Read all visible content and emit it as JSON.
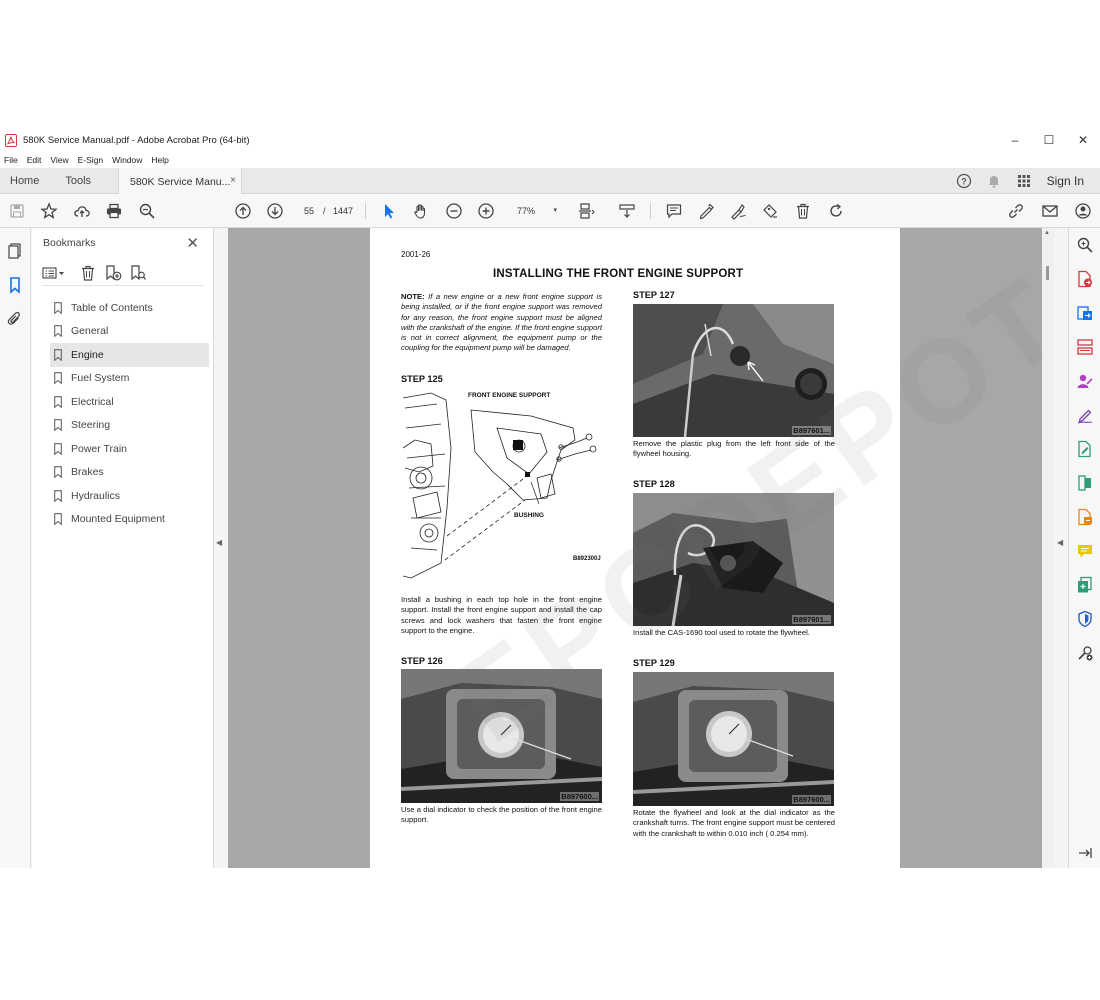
{
  "window": {
    "title": "580K Service Manual.pdf - Adobe Acrobat Pro (64-bit)",
    "controls": [
      "–",
      "☐",
      "✕"
    ]
  },
  "menu": [
    "File",
    "Edit",
    "View",
    "E-Sign",
    "Window",
    "Help"
  ],
  "tabs": {
    "home": "Home",
    "tools": "Tools",
    "document": "580K Service Manu...",
    "close": "×",
    "sign_in": "Sign In"
  },
  "toolbar": {
    "page_current": "55",
    "page_sep": "/",
    "page_total": "1447",
    "zoom": "77%",
    "zoom_caret": "▾"
  },
  "bookmarks": {
    "title": "Bookmarks",
    "close": "✕",
    "items": [
      "Table of Contents",
      "General",
      "Engine",
      "Fuel System",
      "Electrical",
      "Steering",
      "Power Train",
      "Brakes",
      "Hydraulics",
      "Mounted Equipment"
    ],
    "selected": "Engine"
  },
  "document": {
    "page_number": "2001-26",
    "title": "INSTALLING THE FRONT ENGINE SUPPORT",
    "note_label": "NOTE:",
    "note_text": " If a new engine or a new front engine support is being installed, or if the front engine support was removed for any reason, the front engine support must be aligned with the crankshaft of the engine. If the front engine support is not in correct alignment, the equipment pump or the coupling for the equipment pump will be damaged.",
    "steps": [
      {
        "label": "STEP 125",
        "caption": "Install a bushing in each top hole in the front engine support. Install the front engine support and install the cap screws and lock washers that fasten the front engine support to the engine.",
        "figure_code": "B892300J",
        "figure_labels": [
          "FRONT ENGINE SUPPORT",
          "BUSHING"
        ]
      },
      {
        "label": "STEP 126",
        "caption": "Use a dial indicator to check the position of the front engine support.",
        "figure_code": "B897600..."
      },
      {
        "label": "STEP 127",
        "caption": "Remove the plastic plug from the left front side of the flywheel housing.",
        "figure_code": "B897601..."
      },
      {
        "label": "STEP 128",
        "caption": "Install the CAS-1690 tool used to rotate the flywheel.",
        "figure_code": "B897601..."
      },
      {
        "label": "STEP 129",
        "caption": "Rotate the flywheel and look at the dial indicator as the crankshaft turns. The front engine support must be centered with the crankshaft to within 0.010 inch ( 0.254 mm).",
        "figure_code": "B897600..."
      }
    ],
    "watermark": "EPCDEPOT.COM"
  },
  "icons": {
    "left_rail": [
      "pages-icon",
      "bookmark-icon",
      "attachment-icon"
    ],
    "right_rail": [
      "search-zoom-icon",
      "export-pdf-icon",
      "create-pdf-icon",
      "organize-pages-icon",
      "request-signature-icon",
      "fill-sign-icon",
      "edit-pdf-icon",
      "compress-icon",
      "scan-ocr-icon",
      "comment-icon",
      "combine-icon",
      "protect-icon",
      "more-tools-icon",
      "collapse-panel-icon"
    ]
  },
  "colors": {
    "accent": "#1473e6",
    "pdf_red": "#d7373f",
    "doc_bg": "#a7a7a7"
  }
}
